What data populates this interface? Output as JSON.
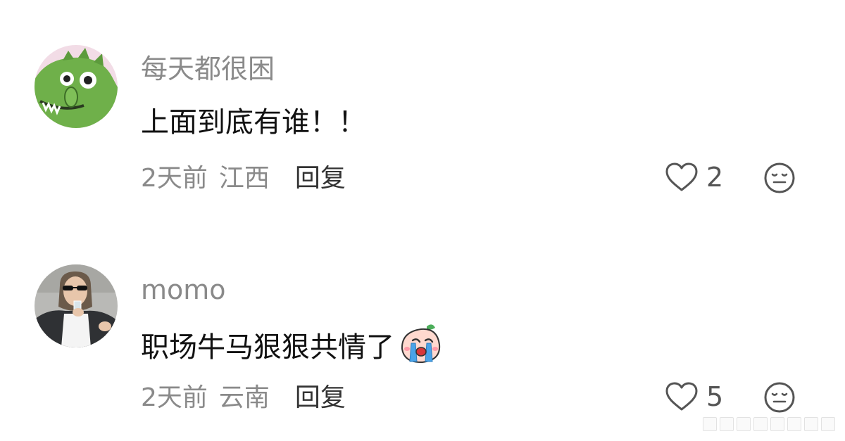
{
  "comments": [
    {
      "username": "每天都很困",
      "text": "上面到底有谁！！",
      "time": "2天前",
      "location": "江西",
      "reply_label": "回复",
      "likes": "2",
      "avatar_icon": "green-dinosaur-avatar"
    },
    {
      "username": "momo",
      "text": "职场牛马狠狠共情了",
      "inline_emoji": "crying-peach-emoji",
      "time": "2天前",
      "location": "云南",
      "reply_label": "回复",
      "likes": "5",
      "avatar_icon": "woman-sunglasses-photo-avatar"
    }
  ],
  "icons": {
    "like": "heart-outline-icon",
    "react": "meh-face-icon"
  },
  "colors": {
    "username": "#8a8a8a",
    "text": "#111111",
    "meta": "#8a8a8a",
    "reply": "#333333",
    "icon": "#555555"
  }
}
